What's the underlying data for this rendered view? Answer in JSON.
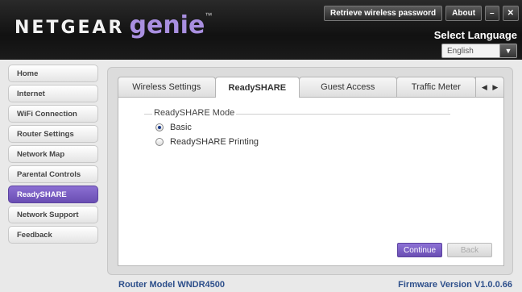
{
  "header": {
    "brand": "NETGEAR",
    "product": "genie",
    "trademark": "™",
    "retrieve_password_label": "Retrieve wireless password",
    "about_label": "About",
    "minimize_label": "–",
    "close_label": "✕",
    "select_language_label": "Select Language",
    "language_value": "English",
    "language_arrow": "▼"
  },
  "sidebar": {
    "items": [
      {
        "label": "Home"
      },
      {
        "label": "Internet"
      },
      {
        "label": "WiFi Connection"
      },
      {
        "label": "Router Settings"
      },
      {
        "label": "Network Map"
      },
      {
        "label": "Parental Controls"
      },
      {
        "label": "ReadySHARE"
      },
      {
        "label": "Network Support"
      },
      {
        "label": "Feedback"
      }
    ],
    "active_index": 6
  },
  "main": {
    "tabs": [
      {
        "label": "Wireless Settings"
      },
      {
        "label": "ReadySHARE"
      },
      {
        "label": "Guest Access"
      },
      {
        "label": "Traffic Meter"
      }
    ],
    "active_tab_index": 1,
    "tab_prev": "◀",
    "tab_next": "▶",
    "mode_legend": "ReadySHARE Mode",
    "options": [
      {
        "label": "Basic",
        "selected": true
      },
      {
        "label": "ReadySHARE Printing",
        "selected": false
      }
    ],
    "continue_label": "Continue",
    "back_label": "Back"
  },
  "footer": {
    "router_model": "Router Model WNDR4500",
    "firmware_version": "Firmware Version V1.0.0.66"
  },
  "colors": {
    "accent": "#7a5fc4",
    "footer_text": "#2d4f8b",
    "header_bg": "#1a1a1a"
  }
}
